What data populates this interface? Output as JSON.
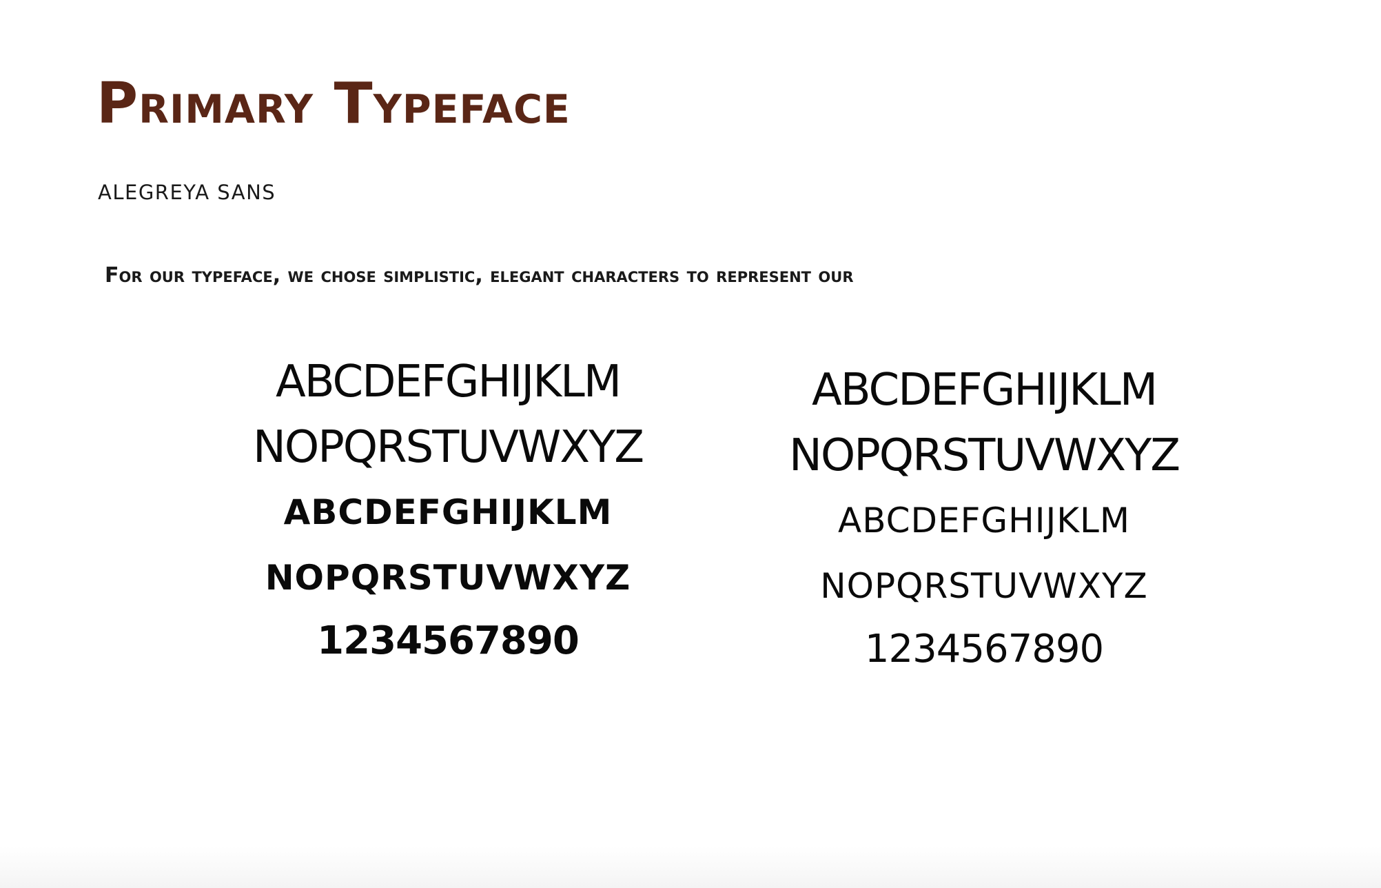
{
  "colors": {
    "title": "#5a2616",
    "body_text": "#1a1a1a",
    "specimen": "#0a0a0a"
  },
  "header": {
    "title": "Primary Typeface",
    "typeface_name": "ALEGREYA SANS"
  },
  "intro": {
    "text": "For our typeface, we chose  simplistic, elegant characters to represent our"
  },
  "specimens": {
    "left": {
      "upper_1": "ABCDEFGHIJKLM",
      "upper_2": "NOPQRSTUVWXYZ",
      "caps_1": "ABCDEFGHIJKLM",
      "caps_2": "NOPQRSTUVWXYZ",
      "digits": "1234567890"
    },
    "right": {
      "upper_1": "ABCDEFGHIJKLM",
      "upper_2": "NOPQRSTUVWXYZ",
      "caps_1": "ABCDEFGHIJKLM",
      "caps_2": "NOPQRSTUVWXYZ",
      "digits": "1234567890"
    }
  }
}
